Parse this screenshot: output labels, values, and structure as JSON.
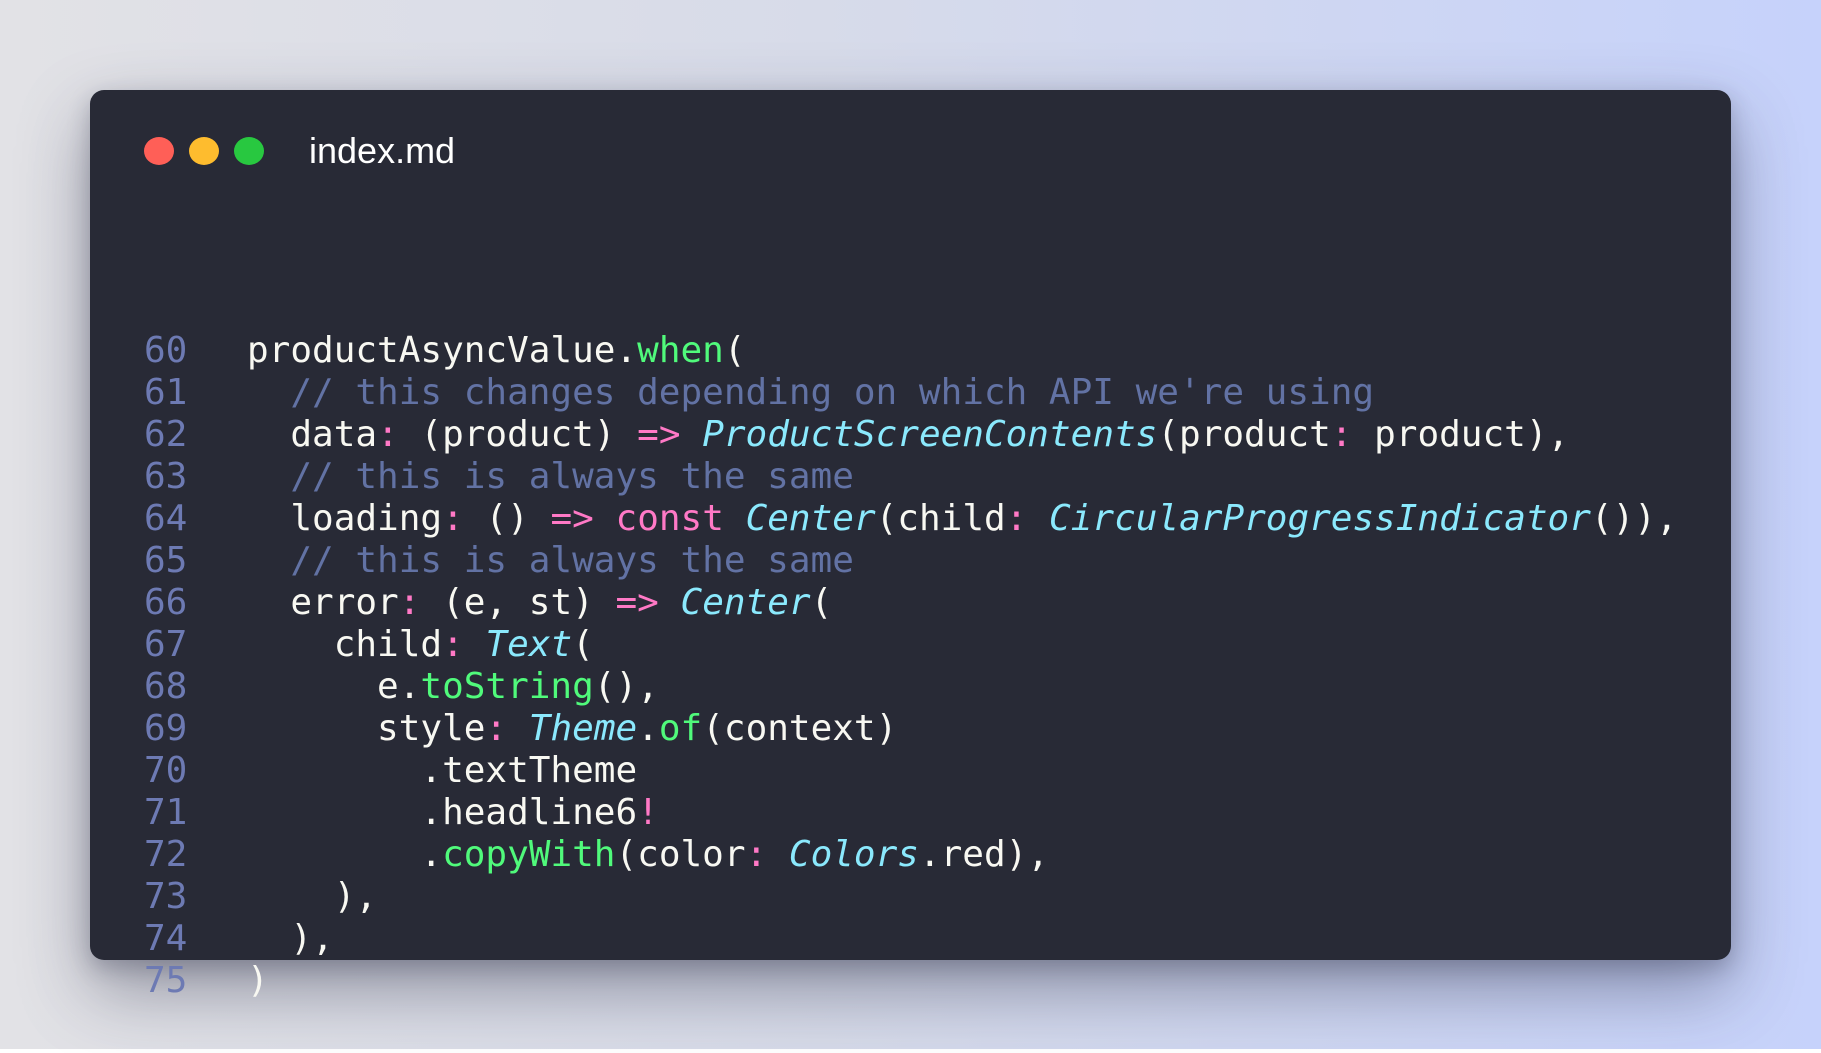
{
  "window": {
    "title": "index.md",
    "controls": [
      {
        "name": "close",
        "color": "#ff5f57"
      },
      {
        "name": "minimize",
        "color": "#febc2e"
      },
      {
        "name": "maximize",
        "color": "#28c840"
      }
    ]
  },
  "theme": {
    "background": "#282a36",
    "line_number": "#6d7ab3",
    "plain": "#f8f8f2",
    "function": "#50fa7b",
    "keyword": "#ff79c6",
    "class": "#8be9fd",
    "comment": "#6272a4"
  },
  "code": {
    "lines": [
      {
        "number": "60",
        "tokens": [
          {
            "t": "productAsyncValue.",
            "k": "plain"
          },
          {
            "t": "when",
            "k": "fn"
          },
          {
            "t": "(",
            "k": "plain"
          }
        ]
      },
      {
        "number": "61",
        "tokens": [
          {
            "t": "  // this changes depending on which API we're using",
            "k": "comment"
          }
        ]
      },
      {
        "number": "62",
        "tokens": [
          {
            "t": "  data",
            "k": "plain"
          },
          {
            "t": ":",
            "k": "pink"
          },
          {
            "t": " (product) ",
            "k": "plain"
          },
          {
            "t": "=>",
            "k": "pink"
          },
          {
            "t": " ",
            "k": "plain"
          },
          {
            "t": "ProductScreenContents",
            "k": "cls"
          },
          {
            "t": "(product",
            "k": "plain"
          },
          {
            "t": ":",
            "k": "pink"
          },
          {
            "t": " product),",
            "k": "plain"
          }
        ]
      },
      {
        "number": "63",
        "tokens": [
          {
            "t": "  // this is always the same",
            "k": "comment"
          }
        ]
      },
      {
        "number": "64",
        "tokens": [
          {
            "t": "  loading",
            "k": "plain"
          },
          {
            "t": ":",
            "k": "pink"
          },
          {
            "t": " () ",
            "k": "plain"
          },
          {
            "t": "=>",
            "k": "pink"
          },
          {
            "t": " ",
            "k": "plain"
          },
          {
            "t": "const",
            "k": "pink"
          },
          {
            "t": " ",
            "k": "plain"
          },
          {
            "t": "Center",
            "k": "cls"
          },
          {
            "t": "(child",
            "k": "plain"
          },
          {
            "t": ":",
            "k": "pink"
          },
          {
            "t": " ",
            "k": "plain"
          },
          {
            "t": "CircularProgressIndicator",
            "k": "cls"
          },
          {
            "t": "()),",
            "k": "plain"
          }
        ]
      },
      {
        "number": "65",
        "tokens": [
          {
            "t": "  // this is always the same",
            "k": "comment"
          }
        ]
      },
      {
        "number": "66",
        "tokens": [
          {
            "t": "  error",
            "k": "plain"
          },
          {
            "t": ":",
            "k": "pink"
          },
          {
            "t": " (e, st) ",
            "k": "plain"
          },
          {
            "t": "=>",
            "k": "pink"
          },
          {
            "t": " ",
            "k": "plain"
          },
          {
            "t": "Center",
            "k": "cls"
          },
          {
            "t": "(",
            "k": "plain"
          }
        ]
      },
      {
        "number": "67",
        "tokens": [
          {
            "t": "    child",
            "k": "plain"
          },
          {
            "t": ":",
            "k": "pink"
          },
          {
            "t": " ",
            "k": "plain"
          },
          {
            "t": "Text",
            "k": "cls"
          },
          {
            "t": "(",
            "k": "plain"
          }
        ]
      },
      {
        "number": "68",
        "tokens": [
          {
            "t": "      e.",
            "k": "plain"
          },
          {
            "t": "toString",
            "k": "fn"
          },
          {
            "t": "(),",
            "k": "plain"
          }
        ]
      },
      {
        "number": "69",
        "tokens": [
          {
            "t": "      style",
            "k": "plain"
          },
          {
            "t": ":",
            "k": "pink"
          },
          {
            "t": " ",
            "k": "plain"
          },
          {
            "t": "Theme",
            "k": "cls"
          },
          {
            "t": ".",
            "k": "plain"
          },
          {
            "t": "of",
            "k": "fn"
          },
          {
            "t": "(context)",
            "k": "plain"
          }
        ]
      },
      {
        "number": "70",
        "tokens": [
          {
            "t": "        .textTheme",
            "k": "plain"
          }
        ]
      },
      {
        "number": "71",
        "tokens": [
          {
            "t": "        .headline6",
            "k": "plain"
          },
          {
            "t": "!",
            "k": "pink"
          }
        ]
      },
      {
        "number": "72",
        "tokens": [
          {
            "t": "        .",
            "k": "plain"
          },
          {
            "t": "copyWith",
            "k": "fn"
          },
          {
            "t": "(color",
            "k": "plain"
          },
          {
            "t": ":",
            "k": "pink"
          },
          {
            "t": " ",
            "k": "plain"
          },
          {
            "t": "Colors",
            "k": "cls"
          },
          {
            "t": ".red),",
            "k": "plain"
          }
        ]
      },
      {
        "number": "73",
        "tokens": [
          {
            "t": "    ),",
            "k": "plain"
          }
        ]
      },
      {
        "number": "74",
        "tokens": [
          {
            "t": "  ),",
            "k": "plain"
          }
        ]
      },
      {
        "number": "75",
        "tokens": [
          {
            "t": ")",
            "k": "plain"
          }
        ]
      }
    ]
  }
}
